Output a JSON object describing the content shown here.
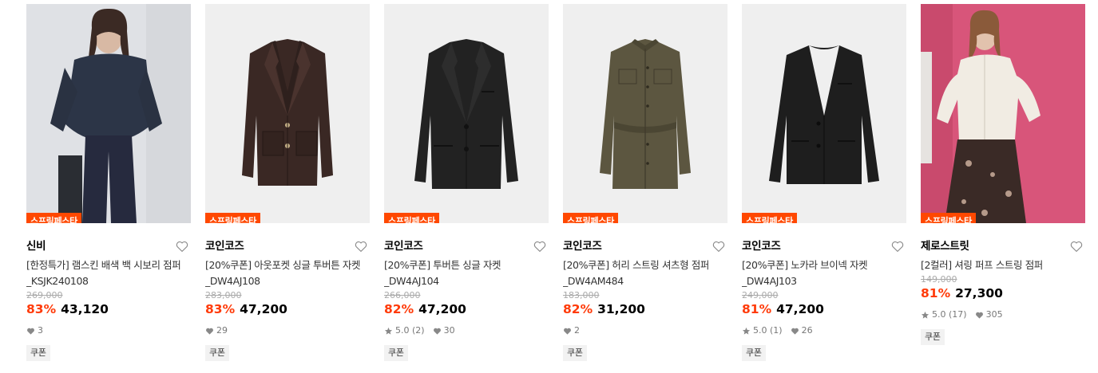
{
  "colors": {
    "accent": "#ff4800",
    "discount": "#ff3b0a",
    "thumb_bg": "#efefef"
  },
  "products": [
    {
      "tag": "스프링페스타",
      "brand": "신비",
      "title": "[한정특가] 램스킨 배색 백 시보리 점퍼_KSJK240108",
      "original_price": "269,000",
      "discount": "83%",
      "price": "43,120",
      "rating": "",
      "likes": "3",
      "badge": "쿠폰",
      "image": "model-navy-jacket"
    },
    {
      "tag": "스프링페스타",
      "brand": "코인코즈",
      "title": "[20%쿠폰] 아웃포켓 싱글 투버튼 자켓_DW4AJ108",
      "original_price": "283,000",
      "discount": "83%",
      "price": "47,200",
      "rating": "",
      "likes": "29",
      "badge": "쿠폰",
      "image": "brown-blazer"
    },
    {
      "tag": "스프링페스타",
      "brand": "코인코즈",
      "title": "[20%쿠폰] 투버튼 싱글 자켓 _DW4AJ104",
      "original_price": "266,000",
      "discount": "82%",
      "price": "47,200",
      "rating": "5.0 (2)",
      "likes": "30",
      "badge": "쿠폰",
      "image": "black-blazer"
    },
    {
      "tag": "스프링페스타",
      "brand": "코인코즈",
      "title": "[20%쿠폰] 허리 스트링 셔츠형 점퍼 _DW4AM484",
      "original_price": "183,000",
      "discount": "82%",
      "price": "31,200",
      "rating": "",
      "likes": "2",
      "badge": "쿠폰",
      "image": "khaki-shirt-jumper"
    },
    {
      "tag": "스프링페스타",
      "brand": "코인코즈",
      "title": "[20%쿠폰] 노카라 브이넥 자켓 _DW4AJ103",
      "original_price": "249,000",
      "discount": "81%",
      "price": "47,200",
      "rating": "5.0 (1)",
      "likes": "26",
      "badge": "쿠폰",
      "image": "black-collarless-jacket"
    },
    {
      "tag": "스프링페스타",
      "brand": "제로스트릿",
      "title": "[2컬러] 셔링 퍼프 스트링 점퍼",
      "original_price": "149,000",
      "discount": "81%",
      "price": "27,300",
      "rating": "5.0 (17)",
      "likes": "305",
      "badge": "쿠폰",
      "image": "model-white-blouse-pink"
    }
  ]
}
